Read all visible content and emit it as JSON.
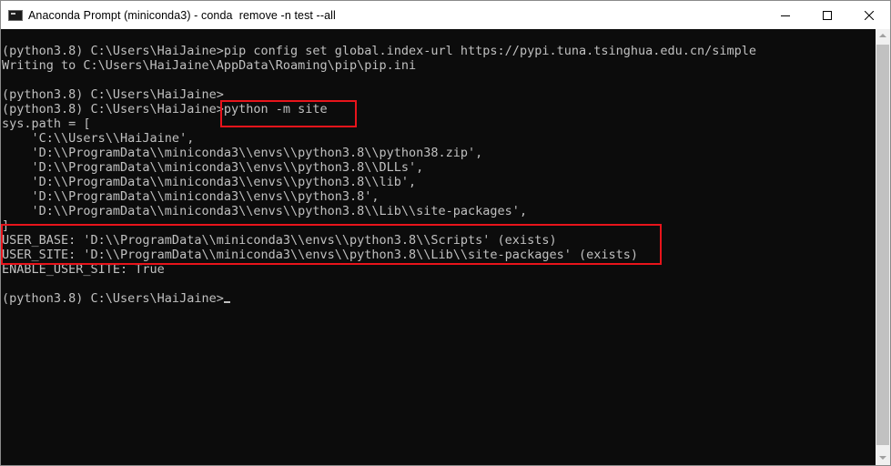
{
  "window": {
    "title": "Anaconda Prompt (miniconda3) - conda  remove -n test --all",
    "app_icon": "console-icon",
    "controls": {
      "minimize_icon": "minimize-icon",
      "maximize_icon": "maximize-icon",
      "close_icon": "close-icon"
    }
  },
  "console": {
    "colors": {
      "background": "#0c0c0c",
      "text": "#c0c0c0",
      "highlight": "#e8141b"
    },
    "lines": [
      "(python3.8) C:\\Users\\HaiJaine>pip config set global.index-url https://pypi.tuna.tsinghua.edu.cn/simple",
      "Writing to C:\\Users\\HaiJaine\\AppData\\Roaming\\pip\\pip.ini",
      "",
      "(python3.8) C:\\Users\\HaiJaine>",
      "(python3.8) C:\\Users\\HaiJaine>python -m site",
      "sys.path = [",
      "    'C:\\\\Users\\\\HaiJaine',",
      "    'D:\\\\ProgramData\\\\miniconda3\\\\envs\\\\python3.8\\\\python38.zip',",
      "    'D:\\\\ProgramData\\\\miniconda3\\\\envs\\\\python3.8\\\\DLLs',",
      "    'D:\\\\ProgramData\\\\miniconda3\\\\envs\\\\python3.8\\\\lib',",
      "    'D:\\\\ProgramData\\\\miniconda3\\\\envs\\\\python3.8',",
      "    'D:\\\\ProgramData\\\\miniconda3\\\\envs\\\\python3.8\\\\Lib\\\\site-packages',",
      "]",
      "USER_BASE: 'D:\\\\ProgramData\\\\miniconda3\\\\envs\\\\python3.8\\\\Scripts' (exists)",
      "USER_SITE: 'D:\\\\ProgramData\\\\miniconda3\\\\envs\\\\python3.8\\\\Lib\\\\site-packages' (exists)",
      "ENABLE_USER_SITE: True",
      "",
      "(python3.8) C:\\Users\\HaiJaine>"
    ]
  }
}
